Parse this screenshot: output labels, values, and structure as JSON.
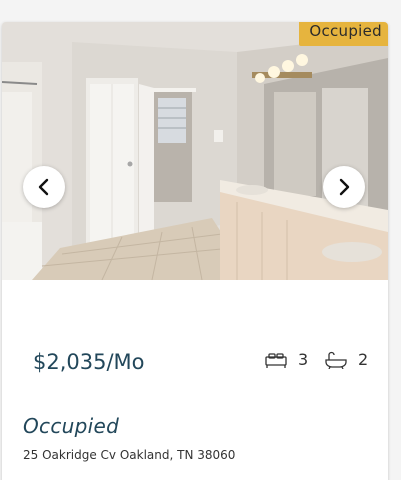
{
  "listing": {
    "status_tag": "Occupied",
    "price": "$2,035/Mo",
    "beds": "3",
    "baths": "2",
    "status_text": "Occupied",
    "address": "25 Oakridge Cv Oakland, TN 38060"
  },
  "icons": {
    "prev": "chevron-left-icon",
    "next": "chevron-right-icon",
    "beds": "bed-icon",
    "baths": "bathtub-icon"
  },
  "colors": {
    "accent": "#22475a",
    "tag_background": "#e6b43e"
  }
}
